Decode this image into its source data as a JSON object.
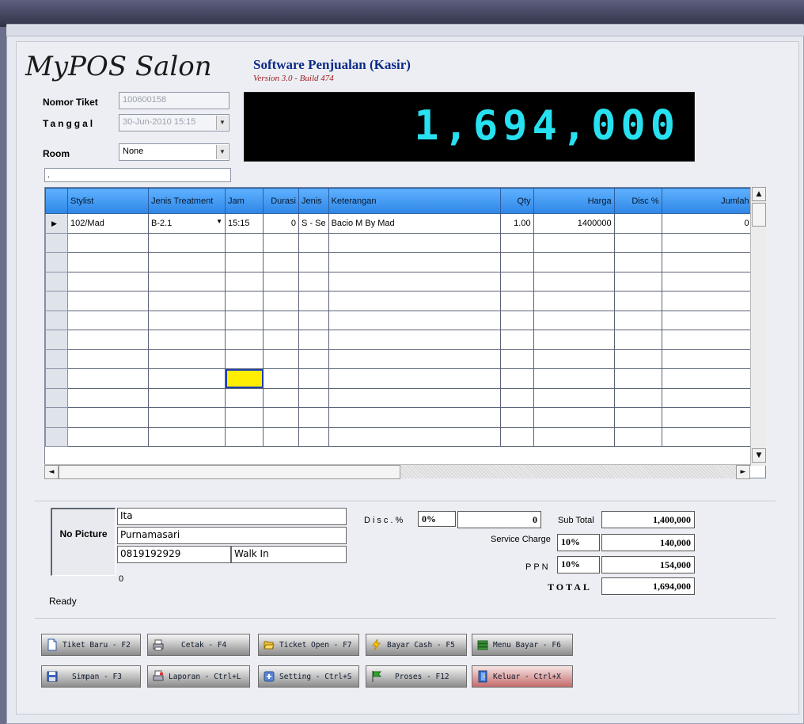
{
  "header": {
    "logo": "MyPOS Salon",
    "title": "Software Penjualan (Kasir)",
    "version": "Version 3.0 - Build 474"
  },
  "form": {
    "nomor_tiket_label": "Nomor Tiket",
    "nomor_tiket_value": "100600158",
    "tanggal_label": "Tanggal",
    "tanggal_value": "30-Jun-2010 15:15",
    "room_label": "Room",
    "room_value": "None",
    "status_field": "."
  },
  "display": {
    "amount": "1,694,000"
  },
  "grid": {
    "columns": [
      "Stylist",
      "Jenis Treatment",
      "Jam",
      "Durasi",
      "Jenis",
      "Keterangan",
      "Qty",
      "Harga",
      "Disc %",
      "Jumlah"
    ],
    "rows": [
      [
        "102/Mad",
        "B-2.1",
        "15:15",
        "0",
        "S - Se",
        "Bacio M By Mad",
        "1.00",
        "1400000",
        "",
        "0"
      ]
    ]
  },
  "customer": {
    "no_picture": "No Picture",
    "first_name": "Ita",
    "last_name": "Purnamasari",
    "phone": "0819192929",
    "type": "Walk In",
    "points": "0",
    "status": "Ready"
  },
  "summary": {
    "disc_label": "Disc.%",
    "disc_pct": "0%",
    "disc_value": "0",
    "subtotal_label": "Sub Total",
    "subtotal_value": "1,400,000",
    "service_label": "Service Charge",
    "service_pct": "10%",
    "service_value": "140,000",
    "ppn_label": "PPN",
    "ppn_pct": "10%",
    "ppn_value": "154,000",
    "total_label": "TOTAL",
    "total_value": "1,694,000"
  },
  "buttons": {
    "tiket_baru": "Tiket Baru - F2",
    "cetak": "Cetak - F4",
    "ticket_open": "Ticket Open - F7",
    "bayar_cash": "Bayar Cash - F5",
    "menu_bayar": "Menu Bayar - F6",
    "simpan": "Simpan - F3",
    "laporan": "Laporan - Ctrl+L",
    "setting": "Setting - Ctrl+S",
    "proses": "Proses - F12",
    "keluar": "Keluar - Ctrl+X"
  },
  "colors": {
    "display_text": "#27e0f0",
    "grid_header": "#3e96f2",
    "active_cell": "#ffee00"
  }
}
